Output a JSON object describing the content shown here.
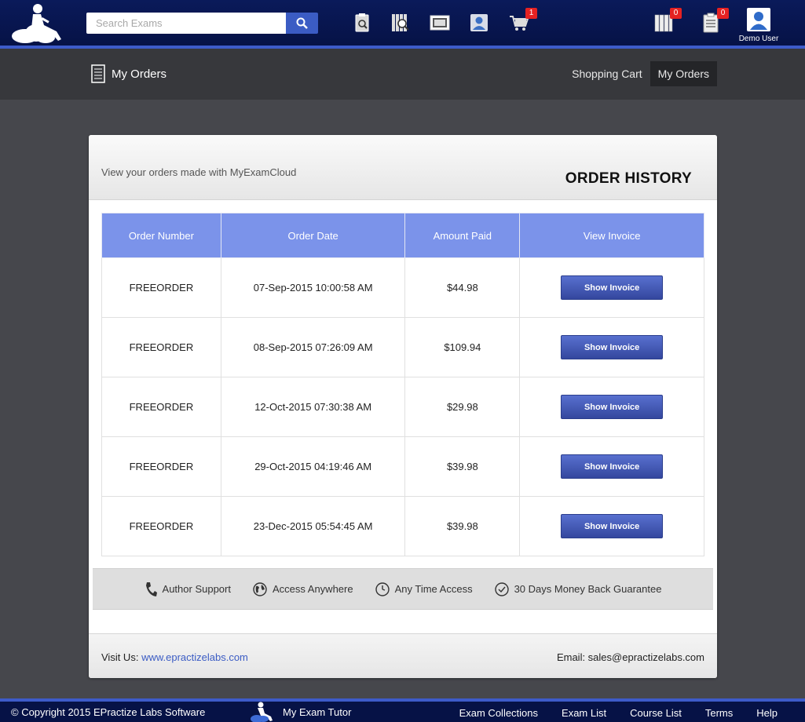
{
  "header": {
    "search_placeholder": "Search Exams",
    "cart_badge": "1",
    "collections_badge": "0",
    "tasks_badge": "0",
    "user_name": "Demo User"
  },
  "subheader": {
    "page_title": "My Orders",
    "nav": [
      "Shopping Cart",
      "My Orders"
    ]
  },
  "card": {
    "subtitle": "View your orders made with MyExamCloud",
    "title": "ORDER HISTORY",
    "columns": [
      "Order Number",
      "Order Date",
      "Amount Paid",
      "View Invoice"
    ],
    "button_label": "Show Invoice",
    "rows": [
      {
        "number": "FREEORDER",
        "date": "07-Sep-2015 10:00:58 AM",
        "amount": "$44.98"
      },
      {
        "number": "FREEORDER",
        "date": "08-Sep-2015 07:26:09 AM",
        "amount": "$109.94"
      },
      {
        "number": "FREEORDER",
        "date": "12-Oct-2015 07:30:38 AM",
        "amount": "$29.98"
      },
      {
        "number": "FREEORDER",
        "date": "29-Oct-2015 04:19:46 AM",
        "amount": "$39.98"
      },
      {
        "number": "FREEORDER",
        "date": "23-Dec-2015 05:54:45 AM",
        "amount": "$39.98"
      }
    ],
    "features": [
      "Author Support",
      "Access Anywhere",
      "Any Time Access",
      "30 Days Money Back Guarantee"
    ],
    "visit_label": "Visit Us:",
    "visit_link": "www.epractizelabs.com",
    "email": "Email: sales@epractizelabs.com"
  },
  "footer": {
    "copyright": "© Copyright 2015 EPractize Labs Software",
    "tutor": "My Exam Tutor",
    "links": [
      "Exam Collections",
      "Exam List",
      "Course List",
      "Terms",
      "Help"
    ]
  },
  "colors": {
    "header_bg": "#061246",
    "accent": "#3d5bc9",
    "table_header": "#7b93ea",
    "badge": "#e52222"
  }
}
